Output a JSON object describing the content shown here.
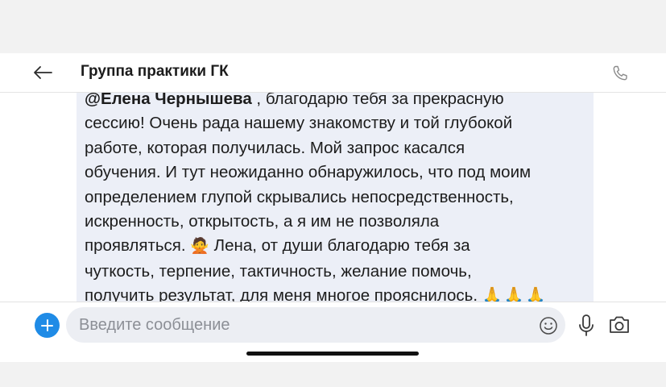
{
  "header": {
    "title": "Группа практики ГК",
    "back_icon": "arrow-left-icon",
    "call_icon": "phone-icon"
  },
  "message": {
    "mention": "@Елена Чернышева",
    "lines": [
      " , благодарю тебя за прекрасную",
      "сессию! Очень рада нашему знакомству и той глубокой",
      "работе, которая получилась. Мой запрос касался",
      "обучения. И тут неожиданно обнаружилось, что под моим",
      "определением глупой скрывались непосредственность,",
      "искренность, открытость, а я им не позволяла",
      "проявляться.",
      " Лена, от души благодарю тебя за",
      "чуткость, терпение,  тактичность, желание помочь,",
      "получить результат, для меня многое прояснилось."
    ],
    "emoji_after_line_7": "person-gesturing-no-emoji",
    "emoji_end": "folded-hands-emoji x3"
  },
  "composer": {
    "placeholder": "Введите сообщение",
    "add_icon": "plus-icon",
    "emoji_icon": "smiley-icon",
    "mic_icon": "microphone-icon",
    "camera_icon": "camera-icon"
  },
  "colors": {
    "accent": "#1f8be6",
    "bubble": "#eceff7",
    "text": "#1c1c1c",
    "placeholder": "#8c8f96"
  }
}
